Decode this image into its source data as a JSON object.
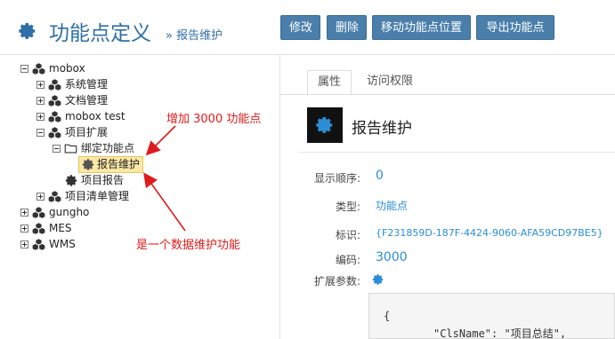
{
  "header": {
    "title": "功能点定义",
    "breadcrumb": "» 报告维护",
    "buttons": [
      "修改",
      "删除",
      "移动功能点位置",
      "导出功能点"
    ]
  },
  "tree": {
    "root": "mobox",
    "children": [
      "系统管理",
      "文档管理",
      "mobox test",
      "项目扩展"
    ],
    "expanded_child": {
      "label": "绑定功能点",
      "items": [
        "报告维护"
      ]
    },
    "project_report": "项目报告",
    "project_list": "项目清单管理",
    "other_roots": [
      "gungho",
      "MES",
      "WMS"
    ]
  },
  "annotations": {
    "add": "增加 3000 功能点",
    "data": "是一个数据维护功能"
  },
  "detail": {
    "tabs": [
      "属性",
      "访问权限"
    ],
    "title": "报告维护",
    "props": {
      "order_label": "显示顺序:",
      "order_value": "0",
      "type_label": "类型:",
      "type_value": "功能点",
      "id_label": "标识:",
      "id_value": "{F231859D-187F-4424-9060-AFA59CD97BE5}",
      "code_label": "编码:",
      "code_value": "3000",
      "ext_label": "扩展参数:"
    },
    "code_lines": [
      "{",
      "\"ClsName\": \"项目总结\","
    ]
  },
  "colors": {
    "accent": "#4a7fab",
    "title": "#2f6fa8",
    "link": "#2a8ed6",
    "annotation": "#e01b1b",
    "selected": "#fde9a6"
  }
}
